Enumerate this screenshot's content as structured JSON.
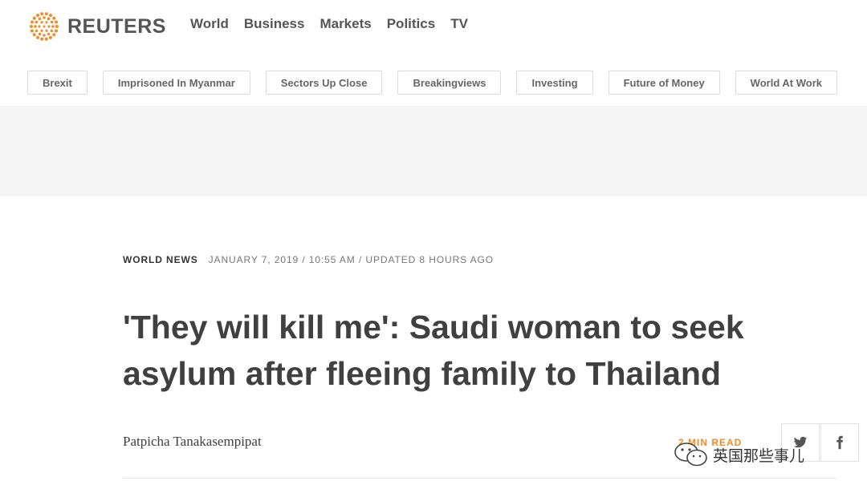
{
  "brand": {
    "name": "REUTERS",
    "accent": "#f28c28"
  },
  "main_nav": [
    "World",
    "Business",
    "Markets",
    "Politics",
    "TV"
  ],
  "sub_nav": [
    "Brexit",
    "Imprisoned In Myanmar",
    "Sectors Up Close",
    "Breakingviews",
    "Investing",
    "Future of Money",
    "World At Work"
  ],
  "article": {
    "section": "WORLD NEWS",
    "dateline": "JANUARY 7, 2019 / 10:55 AM / UPDATED 8 HOURS AGO",
    "headline": "'They will kill me': Saudi woman to seek asylum after fleeing family to Thailand",
    "byline": "Patpicha Tanakasempipat",
    "read_time": "2 MIN READ"
  },
  "share": {
    "twitter_icon": "twitter-icon",
    "facebook_icon": "facebook-icon"
  },
  "watermark": {
    "text": "英国那些事儿",
    "icon": "wechat-icon"
  }
}
